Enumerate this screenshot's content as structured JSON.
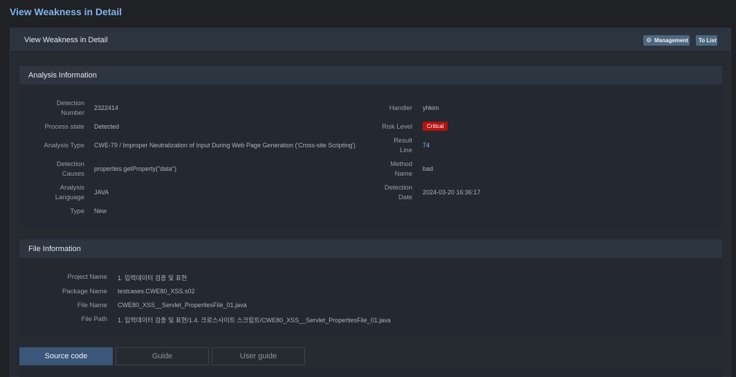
{
  "page": {
    "title": "View Weakness in Detail"
  },
  "panel": {
    "title": "View Weakness in Detail",
    "management_label": "Management",
    "to_list_label": "To List"
  },
  "analysis": {
    "title": "Analysis Information",
    "detection_number_label": [
      "Detection",
      "Number"
    ],
    "detection_number": "2322414",
    "process_state_label": "Process state",
    "process_state": "Detected",
    "analysis_type_label": "Analysis Type",
    "analysis_type": "CWE-79 / Improper Neutralization of Input During Web Page Generation ('Cross-site Scripting')",
    "detection_causes_label": [
      "Detection",
      "Causes"
    ],
    "detection_causes": "properties.getProperty(\"data\")",
    "analysis_language_label": [
      "Analysis",
      "Language"
    ],
    "analysis_language": "JAVA",
    "type_label": "Type",
    "type": "New",
    "handler_label": "Handler",
    "handler": "yhkim",
    "risk_level_label": "Risk Level",
    "risk_level": "Critical",
    "result_line_label": [
      "Result",
      "Line"
    ],
    "result_line": "74",
    "method_name_label": [
      "Method",
      "Name"
    ],
    "method_name": "bad",
    "detection_date_label": [
      "Detection",
      "Date"
    ],
    "detection_date": "2024-03-20 16:36:17"
  },
  "file": {
    "title": "File Information",
    "project_name_label": "Project Name",
    "project_name": "1. 입력데이터 검증 및 표현",
    "package_name_label": "Package Name",
    "package_name": "testcases.CWE80_XSS.s02",
    "file_name_label": "File Name",
    "file_name": "CWE80_XSS__Servlet_PropertiesFile_01.java",
    "file_path_label": "File Path",
    "file_path": "1. 입력데이터 검증 및 표현/1.4. 크로스사이트 스크립트/CWE80_XSS__Servlet_PropertiesFile_01.java"
  },
  "tabs": [
    {
      "label": "Source code",
      "active": true
    },
    {
      "label": "Guide",
      "active": false
    },
    {
      "label": "User guide",
      "active": false
    }
  ],
  "colors": {
    "accent": "#7fb6ea",
    "critical": "#b51212",
    "active_tab": "#3a5678"
  }
}
